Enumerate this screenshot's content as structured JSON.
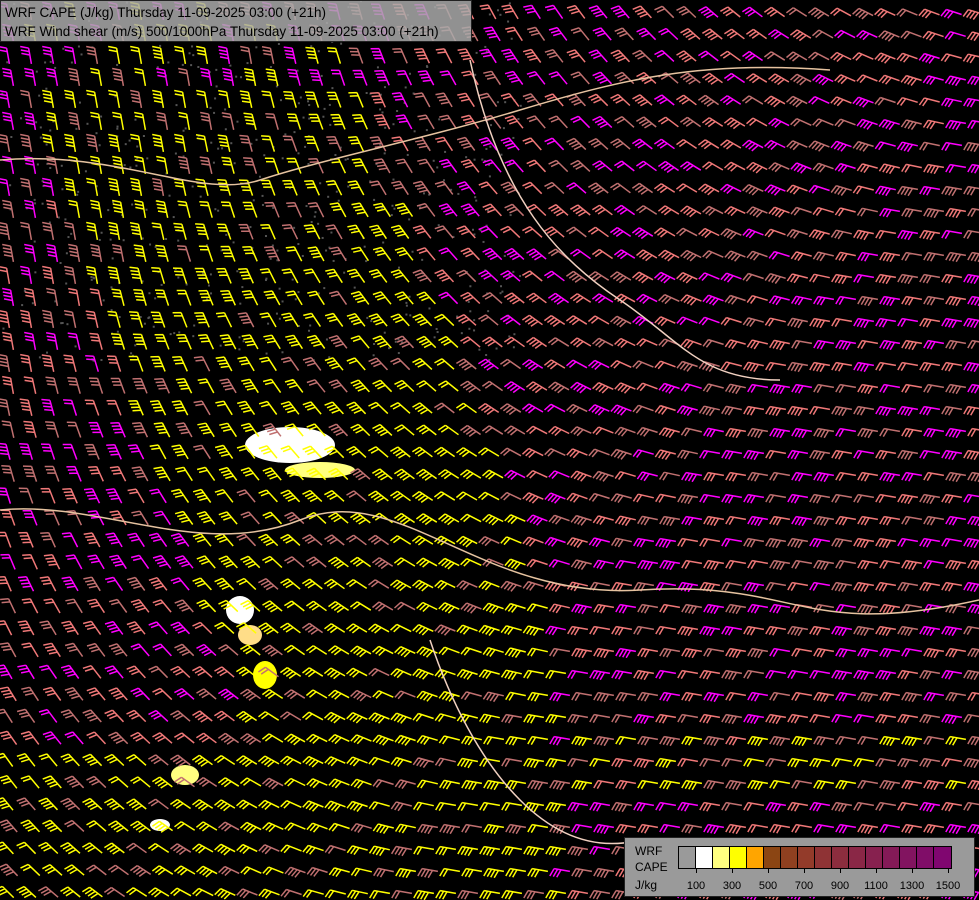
{
  "title": {
    "line1": "WRF CAPE (J/kg) Thursday 11-09-2025 03:00 (+21h)",
    "line2": "WRF Wind shear (m/s) 500/1000hPa Thursday 11-09-2025 03:00 (+21h)"
  },
  "legend": {
    "label1": "WRF",
    "label2": "CAPE",
    "unit": "J/kg",
    "colors": [
      "#9a9a9a",
      "#ffffff",
      "#ffff80",
      "#ffff00",
      "#ffa500",
      "#8b4513",
      "#8f4020",
      "#933b2a",
      "#8f3335",
      "#8c2d3e",
      "#8a2746",
      "#87214f",
      "#841a57",
      "#821460",
      "#800d68",
      "#800670"
    ],
    "ticks": [
      "100",
      "300",
      "500",
      "700",
      "900",
      "1100",
      "1300",
      "1500"
    ]
  },
  "barb_colors": {
    "yellow": "#ffff00",
    "salmon": "#f07878",
    "magenta": "#ff00ff",
    "brown": "#c07070"
  }
}
